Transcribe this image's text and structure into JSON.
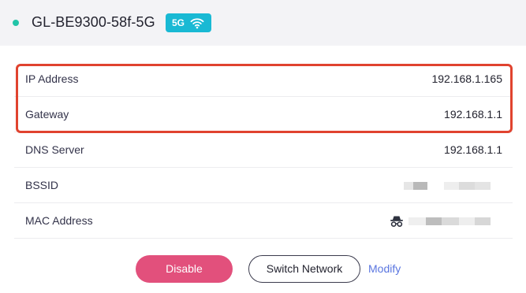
{
  "header": {
    "network_name": "GL-BE9300-58f-5G",
    "band": "5G",
    "status_color": "#21c4a8",
    "badge_color": "#19b9d4"
  },
  "details": {
    "ip_address": {
      "label": "IP Address",
      "value": "192.168.1.165"
    },
    "gateway": {
      "label": "Gateway",
      "value": "192.168.1.1"
    },
    "dns_server": {
      "label": "DNS Server",
      "value": "192.168.1.1"
    },
    "bssid": {
      "label": "BSSID",
      "value_icon": "blurred-redacted"
    },
    "mac_address": {
      "label": "MAC Address",
      "value_icon": "incognito-icon"
    }
  },
  "highlight_color": "#e0432f",
  "actions": {
    "disable_label": "Disable",
    "switch_network_label": "Switch Network",
    "modify_label": "Modify"
  }
}
